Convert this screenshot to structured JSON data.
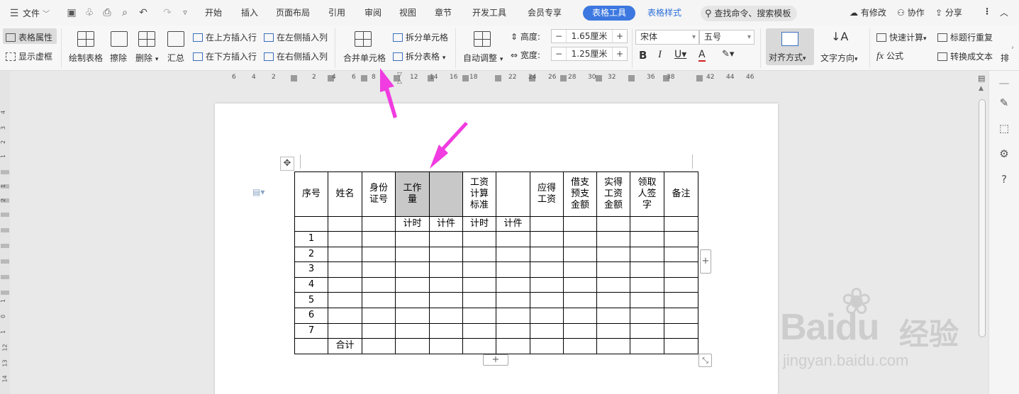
{
  "menubar": {
    "file_label": "文件",
    "tabs": [
      "开始",
      "插入",
      "页面布局",
      "引用",
      "审阅",
      "视图",
      "章节",
      "开发工具",
      "会员专享"
    ],
    "active_tab": "表格工具",
    "second_tab": "表格样式",
    "search_placeholder": "查找命令、搜索模板",
    "right": {
      "modified": "有修改",
      "collab": "协作",
      "share": "分享"
    }
  },
  "toolbar": {
    "table_props": "表格属性",
    "show_gridlines": "显示虚框",
    "draw_table": "绘制表格",
    "erase": "擦除",
    "delete": "删除",
    "summary": "汇总",
    "insert_above": "在上方插入行",
    "insert_below": "在下方插入行",
    "insert_left": "在左侧插入列",
    "insert_right": "在右侧插入列",
    "merge_cells": "合并单元格",
    "split_cells": "拆分单元格",
    "split_table": "拆分表格",
    "auto_adjust": "自动调整",
    "height_label": "高度:",
    "height_value": "1.65厘米",
    "width_label": "宽度:",
    "width_value": "1.25厘米",
    "font_name": "宋体",
    "font_size": "五号",
    "align": "对齐方式",
    "text_dir": "文字方向",
    "quick_calc": "快速计算",
    "repeat_title": "标题行重复",
    "formula": "公式",
    "to_text": "转换成文本",
    "more": "排"
  },
  "ruler": {
    "ticks": [
      "6",
      "4",
      "2",
      "2",
      "4",
      "6",
      "8",
      "12",
      "14",
      "16",
      "18",
      "22",
      "24",
      "26",
      "28",
      "30",
      "32",
      "36",
      "38",
      "42",
      "44",
      "46"
    ]
  },
  "table": {
    "headers": [
      "序号",
      "姓名",
      "身份\n证号",
      "工作\n量",
      "",
      "工资\n计算\n标准",
      "",
      "应得\n工资",
      "借支\n预支\n金额",
      "实得\n工资\n金额",
      "领取\n人签\n字",
      "备注"
    ],
    "subheaders": [
      "",
      "",
      "",
      "计时",
      "计件",
      "计时",
      "计件",
      "",
      "",
      "",
      "",
      ""
    ],
    "row_numbers": [
      "1",
      "2",
      "3",
      "4",
      "5",
      "6",
      "7"
    ],
    "total_label": "合计"
  },
  "vruler": {
    "numbers": [
      "4",
      "3",
      "2",
      "1",
      "1",
      "2",
      "1",
      "0",
      "1",
      "12",
      "13",
      "14"
    ]
  },
  "watermark": {
    "brand": "Baidu",
    "cn": "经验",
    "url": "jingyan.baidu.com"
  },
  "colors": {
    "accent": "#3c78e0",
    "arrow": "#f03ce0",
    "selected_cell": "#c8c8c8"
  }
}
